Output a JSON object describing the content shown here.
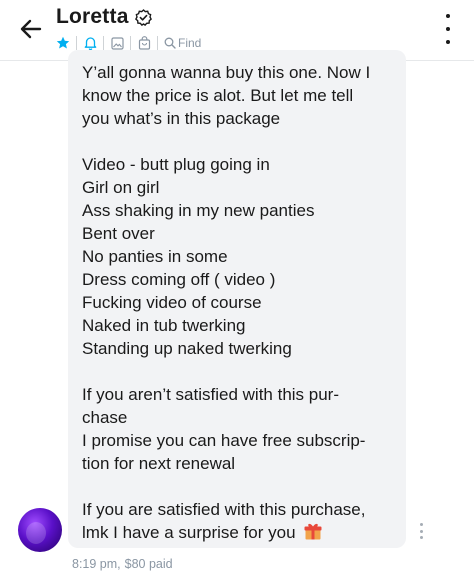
{
  "header": {
    "contact_name": "Loretta",
    "find_label": "Find",
    "colors": {
      "accent": "#00aff0",
      "icon_gray": "#8a96a3"
    }
  },
  "message": {
    "paragraphs": [
      [
        "Y’all gonna wanna buy this one. Now I",
        "know the price is alot. But let me tell",
        "you what’s in this package"
      ],
      [
        "Video - butt plug going in",
        "Girl on girl",
        "Ass shaking in my new panties",
        "Bent over",
        "No panties in some",
        "Dress coming off ( video )",
        "Fucking video of course",
        "Naked in tub twerking",
        "Standing up naked twerking"
      ],
      [
        "If you aren’t satisfied with this pur-",
        "chase",
        "I promise you can have free subscrip-",
        "tion for next renewal"
      ],
      [
        "If you are satisfied with this purchase,",
        "lmk I have a surprise for you"
      ]
    ],
    "time": "8:19 pm,",
    "price": "$80 paid"
  }
}
